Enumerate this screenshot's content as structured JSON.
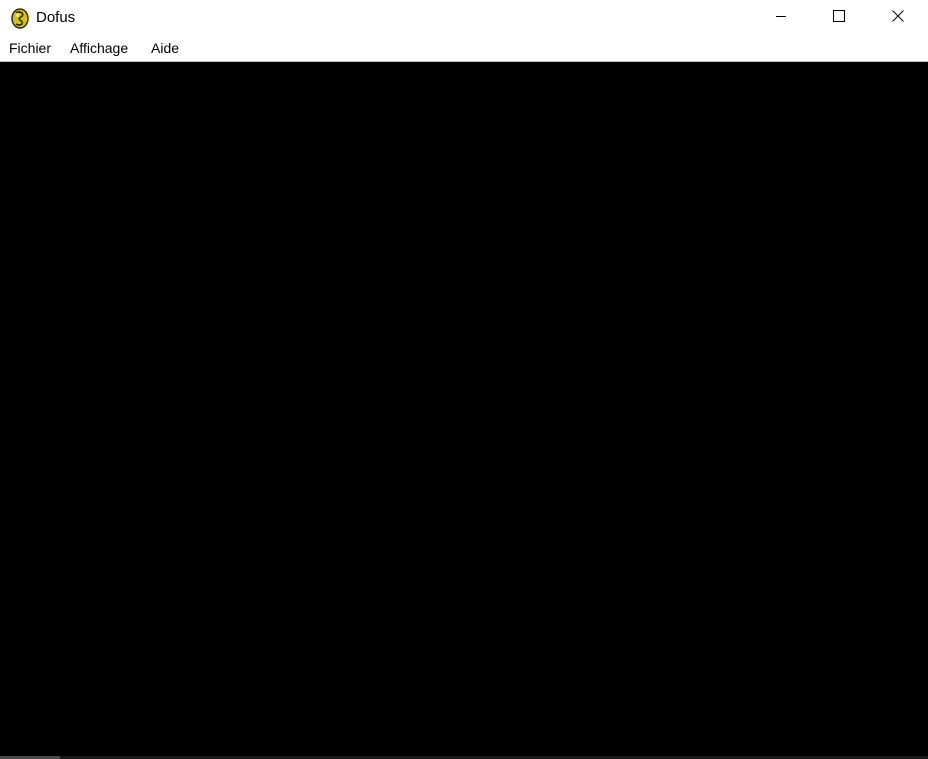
{
  "window": {
    "title": "Dofus",
    "icon": "dofus-egg-icon",
    "controls": {
      "minimize_icon": "minimize-icon",
      "maximize_icon": "maximize-icon",
      "close_icon": "close-icon"
    }
  },
  "menubar": {
    "items": [
      {
        "label": "Fichier"
      },
      {
        "label": "Affichage"
      },
      {
        "label": "Aide"
      }
    ]
  },
  "colors": {
    "canvas_background": "#000000",
    "titlebar_background": "#ffffff",
    "icon_yellow": "#d4c21a",
    "icon_outline": "#3a3a10"
  }
}
